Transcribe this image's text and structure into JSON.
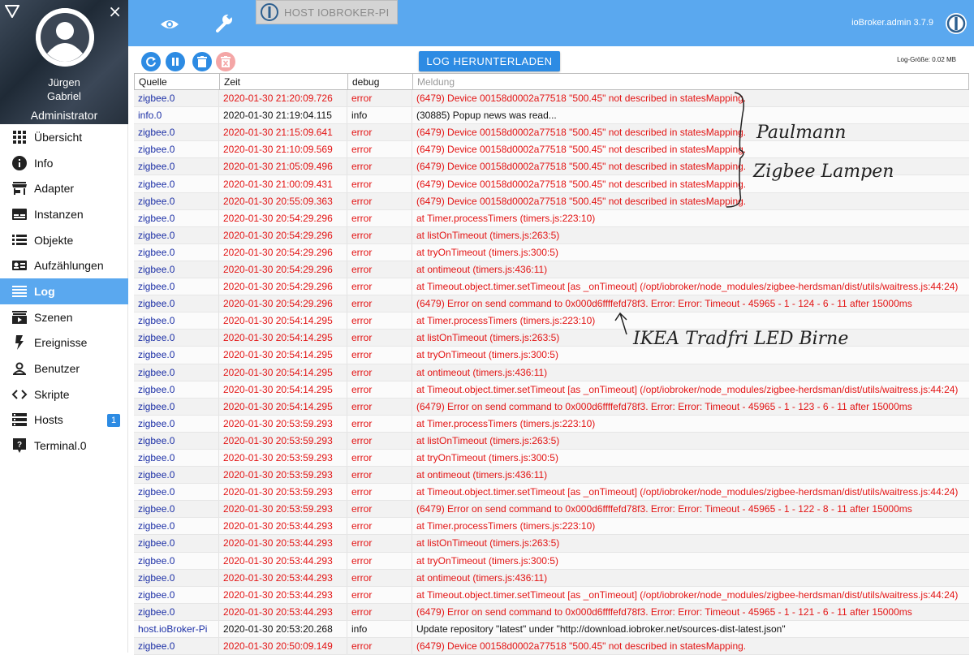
{
  "sidebar": {
    "user": {
      "first_name": "Jürgen",
      "last_name": "Gabriel",
      "role": "Administrator"
    },
    "close_glyph": "×",
    "items": [
      {
        "label": "Übersicht",
        "icon": "apps-grid-icon"
      },
      {
        "label": "Info",
        "icon": "info-icon"
      },
      {
        "label": "Adapter",
        "icon": "store-icon"
      },
      {
        "label": "Instanzen",
        "icon": "instances-icon"
      },
      {
        "label": "Objekte",
        "icon": "list-icon"
      },
      {
        "label": "Aufzählungen",
        "icon": "enum-icon"
      },
      {
        "label": "Log",
        "icon": "log-lines-icon",
        "active": true
      },
      {
        "label": "Szenen",
        "icon": "scenes-icon"
      },
      {
        "label": "Ereignisse",
        "icon": "flash-icon"
      },
      {
        "label": "Benutzer",
        "icon": "user-icon"
      },
      {
        "label": "Skripte",
        "icon": "code-icon"
      },
      {
        "label": "Hosts",
        "icon": "hosts-icon",
        "badge": "1"
      },
      {
        "label": "Terminal.0",
        "icon": "terminal-help-icon"
      }
    ]
  },
  "header": {
    "host_tab": "HOST IOBROKER-PI",
    "version": "ioBroker.admin 3.7.9",
    "accent": "#5aa8ef"
  },
  "toolbar": {
    "download_label": "LOG HERUNTERLADEN",
    "log_size": "Log-Größe: 0.02 MB"
  },
  "table": {
    "headers": {
      "source": "Quelle",
      "time": "Zeit",
      "level": "debug",
      "message": "Meldung"
    },
    "rows": [
      {
        "source": "zigbee.0",
        "time": "2020-01-30 21:20:09.726",
        "level": "error",
        "message": "(6479) Device 00158d0002a77518 \"500.45\" not described in statesMapping."
      },
      {
        "source": "info.0",
        "time": "2020-01-30 21:19:04.115",
        "level": "info",
        "message": "(30885) Popup news was read..."
      },
      {
        "source": "zigbee.0",
        "time": "2020-01-30 21:15:09.641",
        "level": "error",
        "message": "(6479) Device 00158d0002a77518 \"500.45\" not described in statesMapping."
      },
      {
        "source": "zigbee.0",
        "time": "2020-01-30 21:10:09.569",
        "level": "error",
        "message": "(6479) Device 00158d0002a77518 \"500.45\" not described in statesMapping."
      },
      {
        "source": "zigbee.0",
        "time": "2020-01-30 21:05:09.496",
        "level": "error",
        "message": "(6479) Device 00158d0002a77518 \"500.45\" not described in statesMapping."
      },
      {
        "source": "zigbee.0",
        "time": "2020-01-30 21:00:09.431",
        "level": "error",
        "message": "(6479) Device 00158d0002a77518 \"500.45\" not described in statesMapping."
      },
      {
        "source": "zigbee.0",
        "time": "2020-01-30 20:55:09.363",
        "level": "error",
        "message": "(6479) Device 00158d0002a77518 \"500.45\" not described in statesMapping."
      },
      {
        "source": "zigbee.0",
        "time": "2020-01-30 20:54:29.296",
        "level": "error",
        "message": "at Timer.processTimers (timers.js:223:10)"
      },
      {
        "source": "zigbee.0",
        "time": "2020-01-30 20:54:29.296",
        "level": "error",
        "message": "at listOnTimeout (timers.js:263:5)"
      },
      {
        "source": "zigbee.0",
        "time": "2020-01-30 20:54:29.296",
        "level": "error",
        "message": "at tryOnTimeout (timers.js:300:5)"
      },
      {
        "source": "zigbee.0",
        "time": "2020-01-30 20:54:29.296",
        "level": "error",
        "message": "at ontimeout (timers.js:436:11)"
      },
      {
        "source": "zigbee.0",
        "time": "2020-01-30 20:54:29.296",
        "level": "error",
        "message": "at Timeout.object.timer.setTimeout [as _onTimeout] (/opt/iobroker/node_modules/zigbee-herdsman/dist/utils/waitress.js:44:24)"
      },
      {
        "source": "zigbee.0",
        "time": "2020-01-30 20:54:29.296",
        "level": "error",
        "message": "(6479) Error on send command to 0x000d6ffffefd78f3. Error: Error: Timeout - 45965 - 1 - 124 - 6 - 11 after 15000ms"
      },
      {
        "source": "zigbee.0",
        "time": "2020-01-30 20:54:14.295",
        "level": "error",
        "message": "at Timer.processTimers (timers.js:223:10)"
      },
      {
        "source": "zigbee.0",
        "time": "2020-01-30 20:54:14.295",
        "level": "error",
        "message": "at listOnTimeout (timers.js:263:5)"
      },
      {
        "source": "zigbee.0",
        "time": "2020-01-30 20:54:14.295",
        "level": "error",
        "message": "at tryOnTimeout (timers.js:300:5)"
      },
      {
        "source": "zigbee.0",
        "time": "2020-01-30 20:54:14.295",
        "level": "error",
        "message": "at ontimeout (timers.js:436:11)"
      },
      {
        "source": "zigbee.0",
        "time": "2020-01-30 20:54:14.295",
        "level": "error",
        "message": "at Timeout.object.timer.setTimeout [as _onTimeout] (/opt/iobroker/node_modules/zigbee-herdsman/dist/utils/waitress.js:44:24)"
      },
      {
        "source": "zigbee.0",
        "time": "2020-01-30 20:54:14.295",
        "level": "error",
        "message": "(6479) Error on send command to 0x000d6ffffefd78f3. Error: Error: Timeout - 45965 - 1 - 123 - 6 - 11 after 15000ms"
      },
      {
        "source": "zigbee.0",
        "time": "2020-01-30 20:53:59.293",
        "level": "error",
        "message": "at Timer.processTimers (timers.js:223:10)"
      },
      {
        "source": "zigbee.0",
        "time": "2020-01-30 20:53:59.293",
        "level": "error",
        "message": "at listOnTimeout (timers.js:263:5)"
      },
      {
        "source": "zigbee.0",
        "time": "2020-01-30 20:53:59.293",
        "level": "error",
        "message": "at tryOnTimeout (timers.js:300:5)"
      },
      {
        "source": "zigbee.0",
        "time": "2020-01-30 20:53:59.293",
        "level": "error",
        "message": "at ontimeout (timers.js:436:11)"
      },
      {
        "source": "zigbee.0",
        "time": "2020-01-30 20:53:59.293",
        "level": "error",
        "message": "at Timeout.object.timer.setTimeout [as _onTimeout] (/opt/iobroker/node_modules/zigbee-herdsman/dist/utils/waitress.js:44:24)"
      },
      {
        "source": "zigbee.0",
        "time": "2020-01-30 20:53:59.293",
        "level": "error",
        "message": "(6479) Error on send command to 0x000d6ffffefd78f3. Error: Error: Timeout - 45965 - 1 - 122 - 8 - 11 after 15000ms"
      },
      {
        "source": "zigbee.0",
        "time": "2020-01-30 20:53:44.293",
        "level": "error",
        "message": "at Timer.processTimers (timers.js:223:10)"
      },
      {
        "source": "zigbee.0",
        "time": "2020-01-30 20:53:44.293",
        "level": "error",
        "message": "at listOnTimeout (timers.js:263:5)"
      },
      {
        "source": "zigbee.0",
        "time": "2020-01-30 20:53:44.293",
        "level": "error",
        "message": "at tryOnTimeout (timers.js:300:5)"
      },
      {
        "source": "zigbee.0",
        "time": "2020-01-30 20:53:44.293",
        "level": "error",
        "message": "at ontimeout (timers.js:436:11)"
      },
      {
        "source": "zigbee.0",
        "time": "2020-01-30 20:53:44.293",
        "level": "error",
        "message": "at Timeout.object.timer.setTimeout [as _onTimeout] (/opt/iobroker/node_modules/zigbee-herdsman/dist/utils/waitress.js:44:24)"
      },
      {
        "source": "zigbee.0",
        "time": "2020-01-30 20:53:44.293",
        "level": "error",
        "message": "(6479) Error on send command to 0x000d6ffffefd78f3. Error: Error: Timeout - 45965 - 1 - 121 - 6 - 11 after 15000ms"
      },
      {
        "source": "host.ioBroker-Pi",
        "time": "2020-01-30 20:53:20.268",
        "level": "info",
        "message": "Update repository \"latest\" under \"http://download.iobroker.net/sources-dist-latest.json\""
      },
      {
        "source": "zigbee.0",
        "time": "2020-01-30 20:50:09.149",
        "level": "error",
        "message": "(6479) Device 00158d0002a77518 \"500.45\" not described in statesMapping."
      }
    ]
  },
  "annotations": {
    "note1_line1": "Paulmann",
    "note1_line2": "Zigbee Lampen",
    "note2": "IKEA Tradfri LED Birne"
  },
  "colors": {
    "error": "#e31414",
    "source_link": "#1d30a6",
    "active_nav": "#5aa8ef",
    "button": "#2d8be3"
  }
}
